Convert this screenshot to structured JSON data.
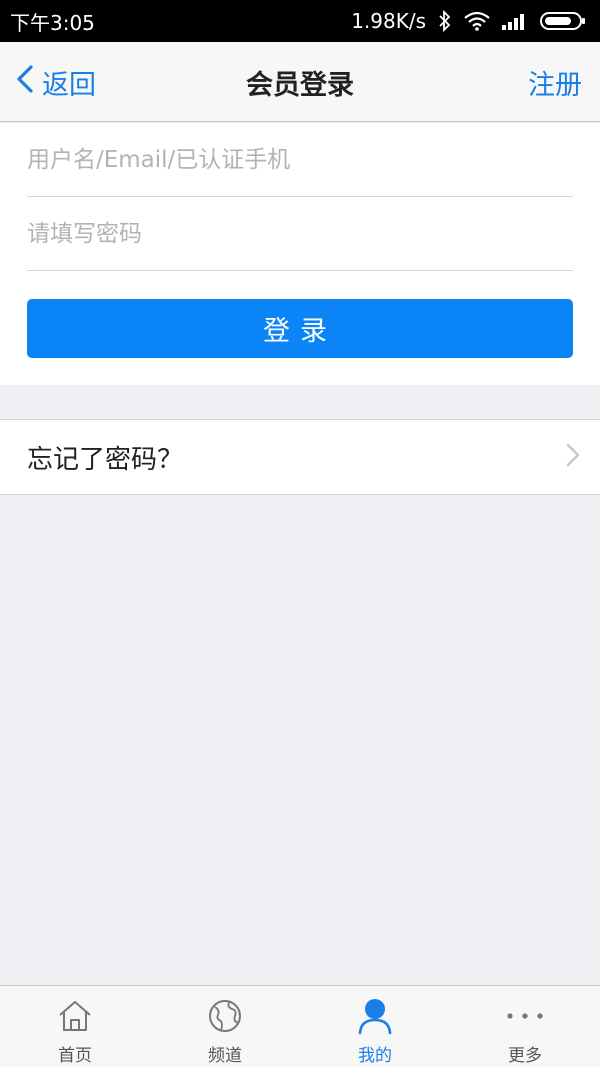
{
  "status_bar": {
    "time": "下午3:05",
    "network_speed": "1.98K/s",
    "icons": [
      "bluetooth-icon",
      "wifi-icon",
      "signal-icon",
      "battery-icon"
    ]
  },
  "nav": {
    "back_label": "返回",
    "title": "会员登录",
    "register_label": "注册"
  },
  "form": {
    "username_placeholder": "用户名/Email/已认证手机",
    "username_value": "",
    "password_placeholder": "请填写密码",
    "password_value": "",
    "login_label": "登录"
  },
  "forgot": {
    "label": "忘记了密码？"
  },
  "tabs": [
    {
      "label": "首页",
      "icon": "home-icon",
      "active": false
    },
    {
      "label": "频道",
      "icon": "globe-icon",
      "active": false
    },
    {
      "label": "我的",
      "icon": "user-icon",
      "active": true
    },
    {
      "label": "更多",
      "icon": "more-icon",
      "active": false
    }
  ],
  "colors": {
    "accent": "#1a7ee8",
    "button": "#0a84f7",
    "background": "#efeff4"
  }
}
